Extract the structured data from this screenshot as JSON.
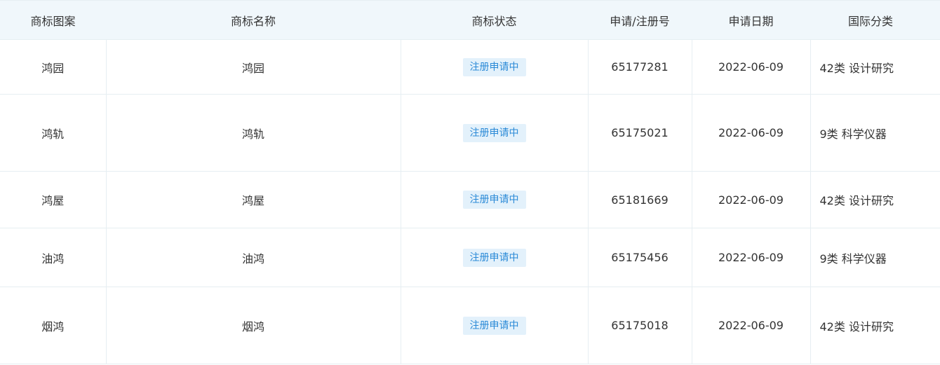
{
  "headers": {
    "pattern": "商标图案",
    "name": "商标名称",
    "status": "商标状态",
    "reg_no": "申请/注册号",
    "date": "申请日期",
    "class": "国际分类"
  },
  "rows": [
    {
      "pattern": "鸿园",
      "name": "鸿园",
      "status": "注册申请中",
      "reg_no": "65177281",
      "date": "2022-06-09",
      "class": "42类 设计研究"
    },
    {
      "pattern": "鸿轨",
      "name": "鸿轨",
      "status": "注册申请中",
      "reg_no": "65175021",
      "date": "2022-06-09",
      "class": "9类 科学仪器"
    },
    {
      "pattern": "鸿屋",
      "name": "鸿屋",
      "status": "注册申请中",
      "reg_no": "65181669",
      "date": "2022-06-09",
      "class": "42类 设计研究"
    },
    {
      "pattern": "油鸿",
      "name": "油鸿",
      "status": "注册申请中",
      "reg_no": "65175456",
      "date": "2022-06-09",
      "class": "9类 科学仪器"
    },
    {
      "pattern": "烟鸿",
      "name": "烟鸿",
      "status": "注册申请中",
      "reg_no": "65175018",
      "date": "2022-06-09",
      "class": "42类 设计研究"
    }
  ],
  "colors": {
    "header_bg": "#f0f7fb",
    "status_bg": "#e3f1fb",
    "status_text": "#2b8ad7",
    "border": "#e6eef2"
  }
}
